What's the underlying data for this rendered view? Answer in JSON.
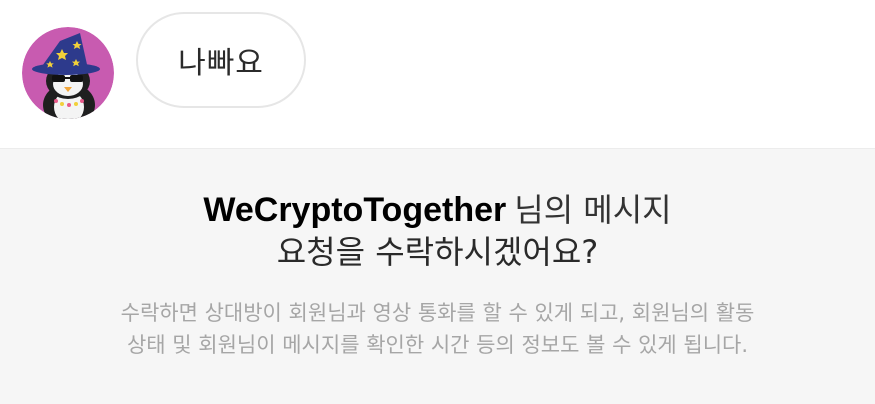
{
  "message": {
    "bubble_text": "나빠요"
  },
  "request": {
    "sender_name": "WeCryptoTogether",
    "title_suffix": "님의 메시지",
    "title_line2": "요청을 수락하시겠어요?",
    "description_line1": "수락하면 상대방이 회원님과 영상 통화를 할 수 있게 되고, 회원님의 활동",
    "description_line2": "상태 및 회원님이 메시지를 확인한 시간 등의 정보도 볼 수 있게 됩니다."
  },
  "colors": {
    "panel_background": "#f6f6f6",
    "avatar_background": "#c85bb0",
    "hat_color": "#2d3a8c",
    "description_text": "#a6a6a6"
  },
  "icons": {
    "avatar": "penguin-wizard-avatar"
  }
}
